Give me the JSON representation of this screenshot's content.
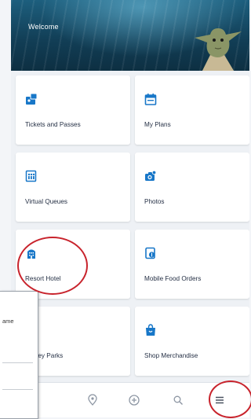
{
  "header": {
    "welcome_text": "Welcome"
  },
  "tiles": [
    {
      "label": "Tickets and Passes",
      "icon": "ticket-icon"
    },
    {
      "label": "My Plans",
      "icon": "calendar-icon"
    },
    {
      "label": "Virtual Queues",
      "icon": "virtual-queue-icon"
    },
    {
      "label": "Photos",
      "icon": "photos-icon"
    },
    {
      "label": "Resort Hotel",
      "icon": "hotel-icon"
    },
    {
      "label": "Mobile Food Orders",
      "icon": "mobile-order-icon"
    },
    {
      "label": "Disney Parks",
      "partial_title": "ay",
      "icon": "disney-parks-icon"
    },
    {
      "label": "Shop Merchandise",
      "icon": "shopping-bag-icon"
    }
  ],
  "popup": {
    "partial_text": "ame"
  },
  "tabbar": {
    "items": [
      "map-pin-icon",
      "add-icon",
      "search-icon",
      "menu-icon"
    ]
  },
  "colors": {
    "accent": "#1877c8",
    "highlight_circle": "#c8232c",
    "tile_text": "#253045"
  }
}
